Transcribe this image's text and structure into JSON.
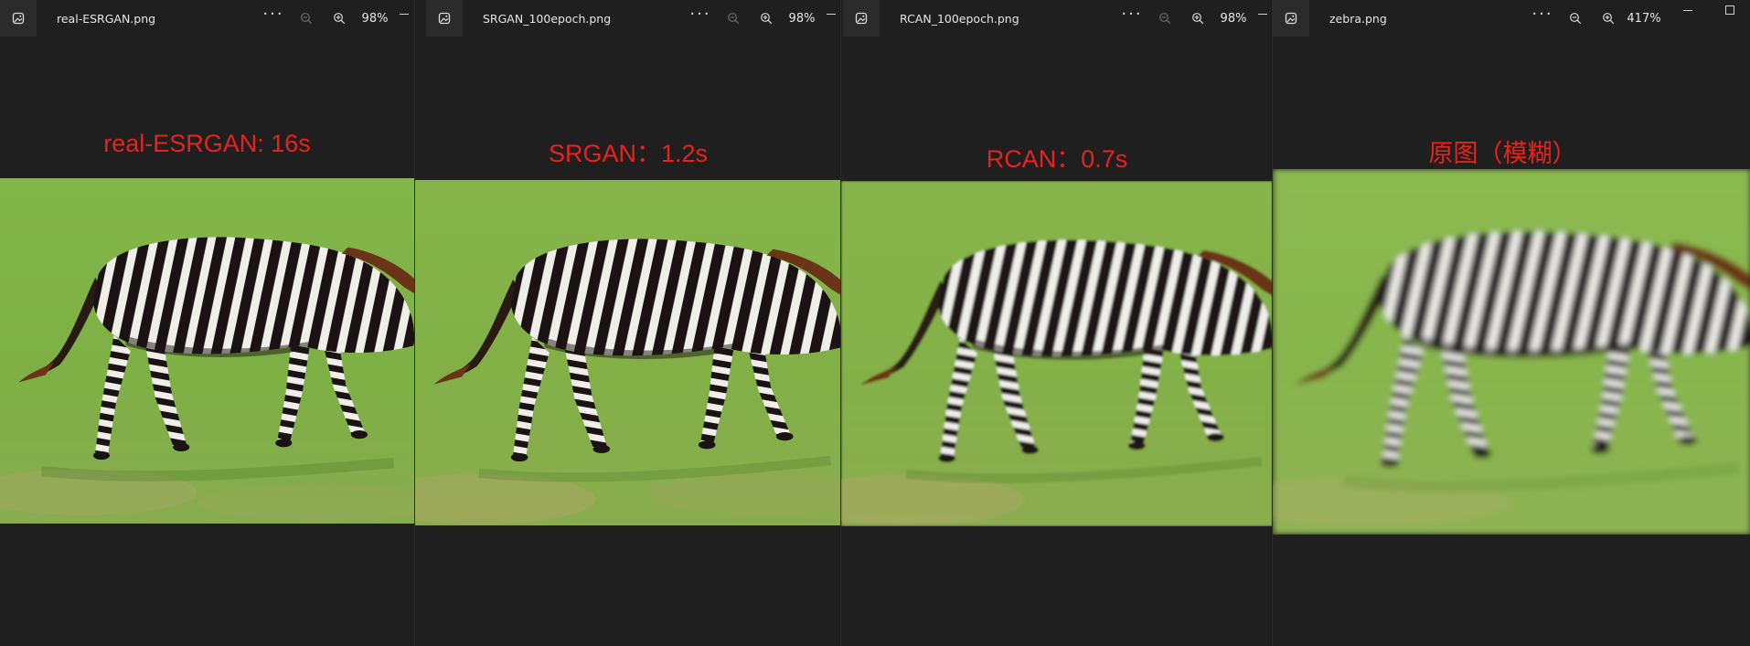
{
  "viewers": [
    {
      "filename": "real-ESRGAN.png",
      "zoom": "98%",
      "caption": "real-ESRGAN: 16s",
      "grass": "#7fb348",
      "grass_dark": "#5f9a2f",
      "image_quality": "sharp"
    },
    {
      "filename": "SRGAN_100epoch.png",
      "zoom": "98%",
      "caption": "SRGAN：1.2s",
      "grass": "#86b24a",
      "grass_dark": "#6a9a34",
      "image_quality": "sharp"
    },
    {
      "filename": "RCAN_100epoch.png",
      "zoom": "98%",
      "caption": "RCAN：0.7s",
      "grass": "#8ab34c",
      "grass_dark": "#6f9c38",
      "image_quality": "soft"
    },
    {
      "filename": "zebra.png",
      "zoom": "417%",
      "caption": "原图（模糊）",
      "grass": "#8fbb54",
      "grass_dark": "#78a640",
      "image_quality": "blurred"
    }
  ],
  "icons": {
    "app": "photo-viewer-icon",
    "more": "more-options-icon",
    "zoom_out": "zoom-out-icon",
    "zoom_in": "zoom-in-icon",
    "minimize": "minimize-icon",
    "maximize": "maximize-icon"
  },
  "colors": {
    "caption_red": "#e8231e",
    "background": "#1e1e1e",
    "zebra_black": "#1b1313",
    "zebra_white": "#efeee9",
    "mane_brown": "#6b3418"
  }
}
